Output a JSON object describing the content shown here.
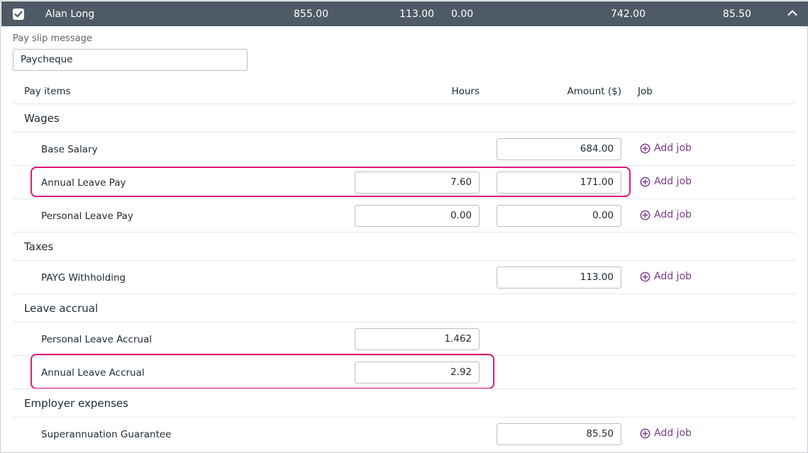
{
  "employee_row": {
    "checked": true,
    "name": "Alan Long",
    "values": [
      "855.00",
      "113.00",
      "0.00",
      "742.00",
      "85.50"
    ]
  },
  "payslip": {
    "label": "Pay slip message",
    "value": "Paycheque"
  },
  "columns": {
    "pay_items": "Pay items",
    "hours": "Hours",
    "amount": "Amount ($)",
    "job": "Job"
  },
  "add_job_label": "Add job",
  "sections": {
    "wages": {
      "title": "Wages",
      "items": [
        {
          "label": "Base Salary",
          "hours": null,
          "amount": "684.00",
          "add_job": true
        },
        {
          "label": "Annual Leave Pay",
          "hours": "7.60",
          "amount": "171.00",
          "add_job": true
        },
        {
          "label": "Personal Leave Pay",
          "hours": "0.00",
          "amount": "0.00",
          "add_job": true
        }
      ]
    },
    "taxes": {
      "title": "Taxes",
      "items": [
        {
          "label": "PAYG Withholding",
          "hours": null,
          "amount": "113.00",
          "add_job": true
        }
      ]
    },
    "leave_accrual": {
      "title": "Leave accrual",
      "items": [
        {
          "label": "Personal Leave Accrual",
          "hours": "1.462",
          "amount": null,
          "add_job": false
        },
        {
          "label": "Annual Leave Accrual",
          "hours": "2.92",
          "amount": null,
          "add_job": false
        }
      ]
    },
    "employer_expenses": {
      "title": "Employer expenses",
      "items": [
        {
          "label": "Superannuation Guarantee",
          "hours": null,
          "amount": "85.50",
          "add_job": true
        }
      ]
    }
  },
  "colors": {
    "header_bg": "#4e5b66",
    "accent_purple": "#7b3b8a",
    "highlight_pink": "#e0177a"
  }
}
